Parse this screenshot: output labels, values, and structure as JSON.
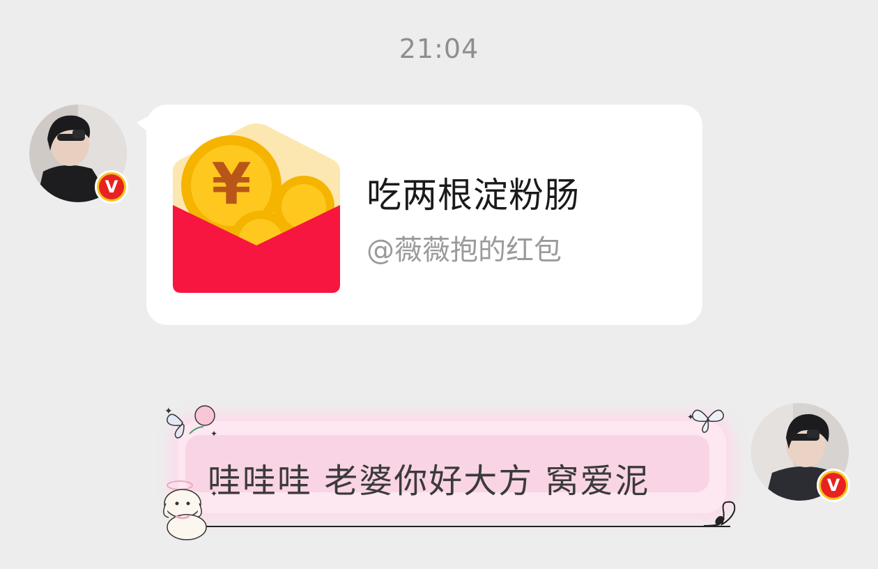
{
  "chat": {
    "timestamp": "21:04",
    "messages": [
      {
        "type": "red_packet",
        "side": "left",
        "title": "吃两根淀粉肠",
        "sender_note": "@薇薇抱的红包",
        "icon": "red-packet-icon",
        "verified_badge": "V"
      },
      {
        "type": "text",
        "side": "right",
        "text": "哇哇哇 老婆你好大方 窝爱泥",
        "verified_badge": "V"
      }
    ]
  },
  "colors": {
    "background": "#ededed",
    "bubble": "#ffffff",
    "packet_red": "#f7163f",
    "coin_gold": "#f5b400",
    "pink_bubble": "#fde7f1",
    "badge_yellow": "#f7c21a",
    "badge_red": "#e8231f"
  }
}
